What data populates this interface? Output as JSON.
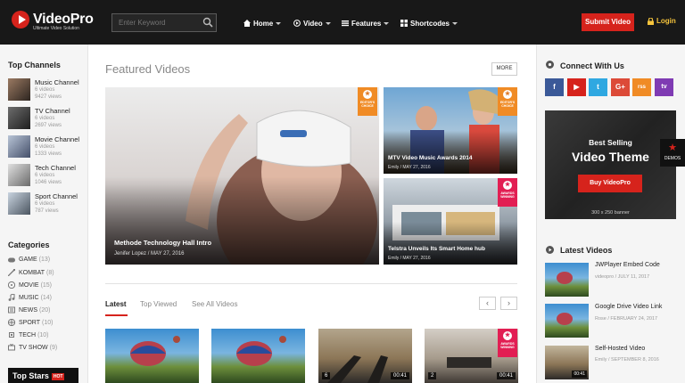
{
  "header": {
    "logo_text": "VideoPro",
    "logo_tagline": "Ultimate Video Solution",
    "search_placeholder": "Enter Keyword",
    "nav": [
      "Home",
      "Video",
      "Features",
      "Shortcodes"
    ],
    "submit_label": "Submit Video",
    "login_label": "Login",
    "accent": "#d6231c"
  },
  "left": {
    "top_channels_title": "Top Channels",
    "channels": [
      {
        "name": "Music Channel",
        "videos": "6 videos",
        "views": "9427 views"
      },
      {
        "name": "TV Channel",
        "videos": "6 videos",
        "views": "2697 views"
      },
      {
        "name": "Movie Channel",
        "videos": "6 videos",
        "views": "1333 views"
      },
      {
        "name": "Tech Channel",
        "videos": "6 videos",
        "views": "1046 views"
      },
      {
        "name": "Sport Channel",
        "videos": "6 videos",
        "views": "787 views"
      }
    ],
    "categories_title": "Categories",
    "categories": [
      {
        "name": "GAME",
        "count": "(13)"
      },
      {
        "name": "KOMBAT",
        "count": "(8)"
      },
      {
        "name": "MOVIE",
        "count": "(15)"
      },
      {
        "name": "MUSIC",
        "count": "(14)"
      },
      {
        "name": "NEWS",
        "count": "(20)"
      },
      {
        "name": "SPORT",
        "count": "(10)"
      },
      {
        "name": "TECH",
        "count": "(10)"
      },
      {
        "name": "TV SHOW",
        "count": "(9)"
      }
    ],
    "top_stars": "Top Stars",
    "hot": "HOT"
  },
  "main": {
    "featured_title": "Featured Videos",
    "more_label": "MORE",
    "big": {
      "title": "Methode Technology Hall Intro",
      "meta": "Jenifer Lopez  /  MAY 27, 2016"
    },
    "small": [
      {
        "title": "MTV Video Music Awards 2014",
        "meta": "Emily  /  MAY 27, 2016",
        "badge": "EDITOR'S CHOICE"
      },
      {
        "title": "Telstra Unveils Its Smart Home hub",
        "meta": "Emily  /  MAY 27, 2016",
        "badge": "AWARDS WINNING"
      }
    ],
    "big_badge": "EDITOR'S CHOICE",
    "tabs": [
      "Latest",
      "Top Viewed",
      "See All Videos"
    ],
    "thumbs": [
      {
        "count": "",
        "dur": ""
      },
      {
        "count": "",
        "dur": ""
      },
      {
        "count": "6",
        "dur": "00:41"
      },
      {
        "count": "2",
        "dur": "00:41"
      }
    ],
    "thumb4_badge": "AWARDS WINNING"
  },
  "right": {
    "connect_title": "Connect With Us",
    "social": [
      {
        "label": "f",
        "color": "#3b5998",
        "icon": "facebook-icon"
      },
      {
        "label": "▶",
        "color": "#d6231c",
        "icon": "youtube-icon"
      },
      {
        "label": "t",
        "color": "#2fa8e1",
        "icon": "twitter-icon"
      },
      {
        "label": "G+",
        "color": "#dc4a38",
        "icon": "google-plus-icon"
      },
      {
        "label": "rss",
        "color": "#f08b25",
        "icon": "rss-icon"
      },
      {
        "label": "tv",
        "color": "#7f3bb3",
        "icon": "twitch-icon"
      }
    ],
    "banner": {
      "line1": "Best Selling",
      "line2": "Video Theme",
      "button": "Buy VideoPro",
      "size": "300 x 250 banner"
    },
    "demos": "DEMOS",
    "latest_title": "Latest Videos",
    "latest": [
      {
        "title": "JWPlayer Embed Code",
        "meta": "videopro  /  JULY 11, 2017",
        "dur": ""
      },
      {
        "title": "Google Drive Video Link",
        "meta": "Rose  /  FEBRUARY 24, 2017",
        "dur": ""
      },
      {
        "title": "Self-Hosted Video",
        "meta": "Emily  /  SEPTEMBER 8, 2016",
        "dur": "00:41"
      }
    ]
  }
}
